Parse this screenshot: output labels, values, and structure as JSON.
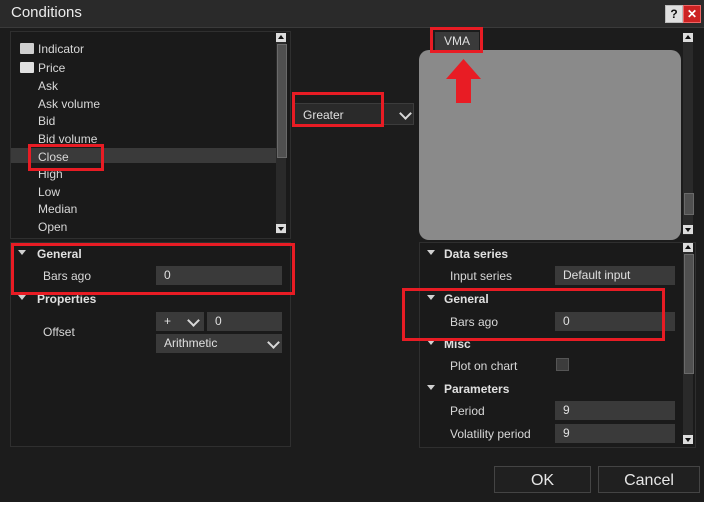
{
  "window": {
    "title": "Conditions",
    "help_label": "?",
    "close_label": "✕"
  },
  "left_tree": {
    "items": [
      {
        "label": "Indicator"
      },
      {
        "label": "Price"
      },
      {
        "label": "Ask"
      },
      {
        "label": "Ask volume"
      },
      {
        "label": "Bid"
      },
      {
        "label": "Bid volume"
      },
      {
        "label": "Close"
      },
      {
        "label": "High"
      },
      {
        "label": "Low"
      },
      {
        "label": "Median"
      },
      {
        "label": "Open"
      }
    ]
  },
  "left_props": {
    "general_header": "General",
    "bars_ago_label": "Bars ago",
    "bars_ago_value": "0",
    "properties_header": "Properties",
    "offset_label": "Offset",
    "offset_op": "+",
    "offset_value": "0",
    "offset_type": "Arithmetic"
  },
  "operator": {
    "value": "Greater"
  },
  "right_tab": {
    "label": "VMA"
  },
  "right_props": {
    "data_series_header": "Data series",
    "input_series_label": "Input series",
    "input_series_value": "Default input",
    "general_header": "General",
    "bars_ago_label": "Bars ago",
    "bars_ago_value": "0",
    "misc_header": "Misc",
    "plot_on_chart_label": "Plot on chart",
    "parameters_header": "Parameters",
    "period_label": "Period",
    "period_value": "9",
    "volatility_period_label": "Volatility period",
    "volatility_period_value": "9"
  },
  "buttons": {
    "ok": "OK",
    "cancel": "Cancel"
  },
  "colors": {
    "highlight": "#e81c24",
    "background": "#1c1c1c",
    "field": "#3a3a3a"
  }
}
